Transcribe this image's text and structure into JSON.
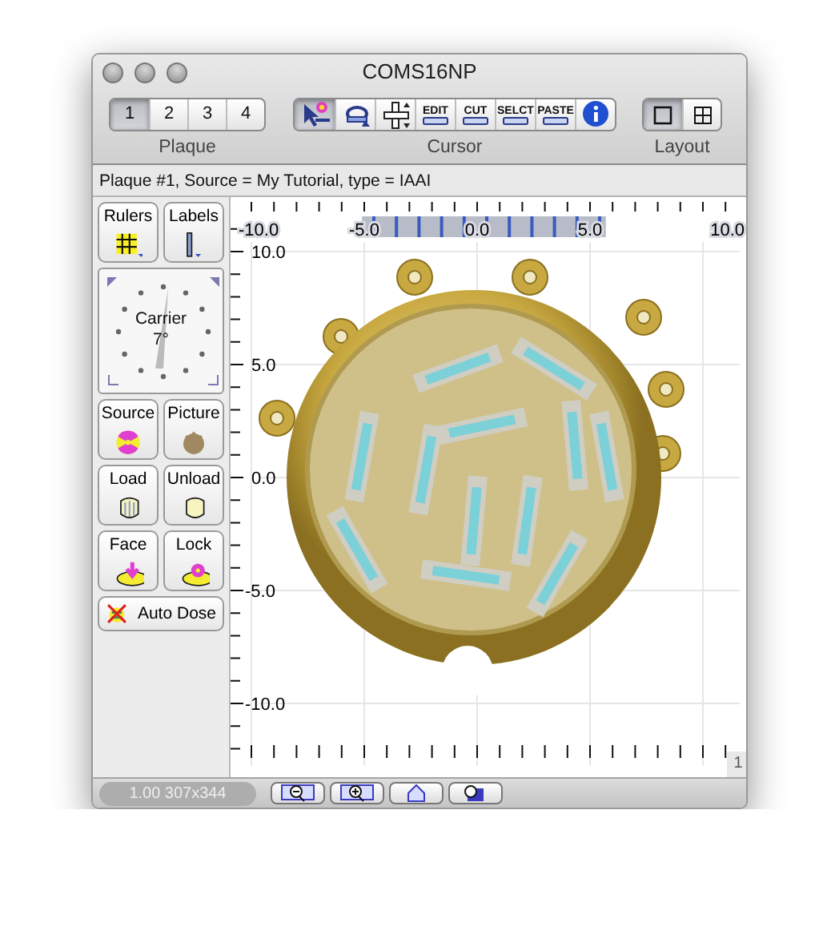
{
  "window": {
    "title": "COMS16NP"
  },
  "toolbar": {
    "plaque": {
      "label": "Plaque",
      "buttons": [
        {
          "label": "1",
          "selected": true
        },
        {
          "label": "2",
          "selected": false
        },
        {
          "label": "3",
          "selected": false
        },
        {
          "label": "4",
          "selected": false
        }
      ]
    },
    "cursor": {
      "label": "Cursor",
      "tools": [
        {
          "kind": "pointer",
          "selected": true
        },
        {
          "kind": "rotate",
          "selected": false
        },
        {
          "kind": "move",
          "selected": false
        },
        {
          "kind": "text",
          "label": "EDIT",
          "selected": false
        },
        {
          "kind": "text",
          "label": "CUT",
          "selected": false
        },
        {
          "kind": "text",
          "label": "SELCT",
          "selected": false
        },
        {
          "kind": "text",
          "label": "PASTE",
          "selected": false
        },
        {
          "kind": "info",
          "selected": false
        }
      ]
    },
    "layout": {
      "label": "Layout",
      "buttons": [
        {
          "kind": "single",
          "selected": true
        },
        {
          "kind": "grid",
          "selected": false
        }
      ]
    }
  },
  "status": "Plaque #1, Source = My Tutorial, type = IAAI",
  "side_panel": {
    "tools": [
      {
        "kind": "rulers",
        "label": "Rulers"
      },
      {
        "kind": "labels",
        "label": "Labels"
      }
    ],
    "carrier": {
      "label": "Carrier",
      "angle": "7°"
    },
    "buttons": [
      {
        "kind": "source",
        "label": "Source"
      },
      {
        "kind": "picture",
        "label": "Picture"
      },
      {
        "kind": "load",
        "label": "Load"
      },
      {
        "kind": "unload",
        "label": "Unload"
      },
      {
        "kind": "face",
        "label": "Face"
      },
      {
        "kind": "lock",
        "label": "Lock"
      }
    ],
    "auto_dose": {
      "label": "Auto Dose"
    }
  },
  "canvas": {
    "x_labels": [
      "-10.0",
      "-5.0",
      "0.0",
      "5.0",
      "10.0"
    ],
    "y_labels": [
      "10.0",
      "5.0",
      "0.0",
      "-5.0",
      "-10.0"
    ],
    "corner": "1"
  },
  "bottom_bar": {
    "zoom": "1.00 307x344",
    "buttons": [
      {
        "kind": "zoom-out"
      },
      {
        "kind": "zoom-in"
      },
      {
        "kind": "home"
      },
      {
        "kind": "zoom-fit"
      }
    ]
  }
}
